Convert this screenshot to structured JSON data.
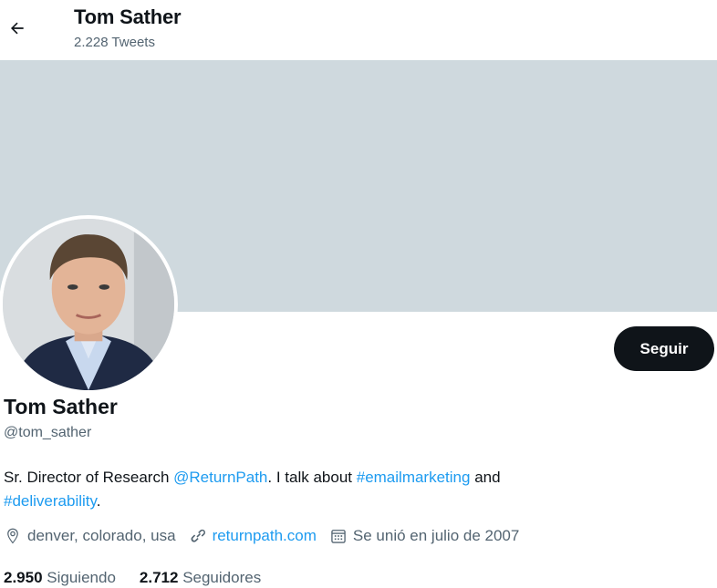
{
  "header": {
    "title": "Tom Sather",
    "subtitle": "2.228 Tweets"
  },
  "profile": {
    "display_name": "Tom Sather",
    "handle": "@tom_sather",
    "follow_label": "Seguir",
    "bio": {
      "part1": "Sr. Director of Research ",
      "mention": "@ReturnPath",
      "part2": ". I talk about ",
      "hashtag1": "#emailmarketing",
      "part3": " and ",
      "hashtag2": "#deliverability",
      "part4": "."
    },
    "location": "denver, colorado, usa",
    "website": "returnpath.com",
    "joined": "Se unió en julio de 2007",
    "following_count": "2.950",
    "following_label": "Siguiendo",
    "followers_count": "2.712",
    "followers_label": "Seguidores"
  },
  "icons": {
    "back": "arrow-left-icon",
    "location": "location-pin-icon",
    "link": "link-icon",
    "calendar": "calendar-icon"
  },
  "colors": {
    "accent": "#1d9bf0",
    "banner": "#cfd9de",
    "button": "#0f1419",
    "secondary_text": "#536471"
  }
}
